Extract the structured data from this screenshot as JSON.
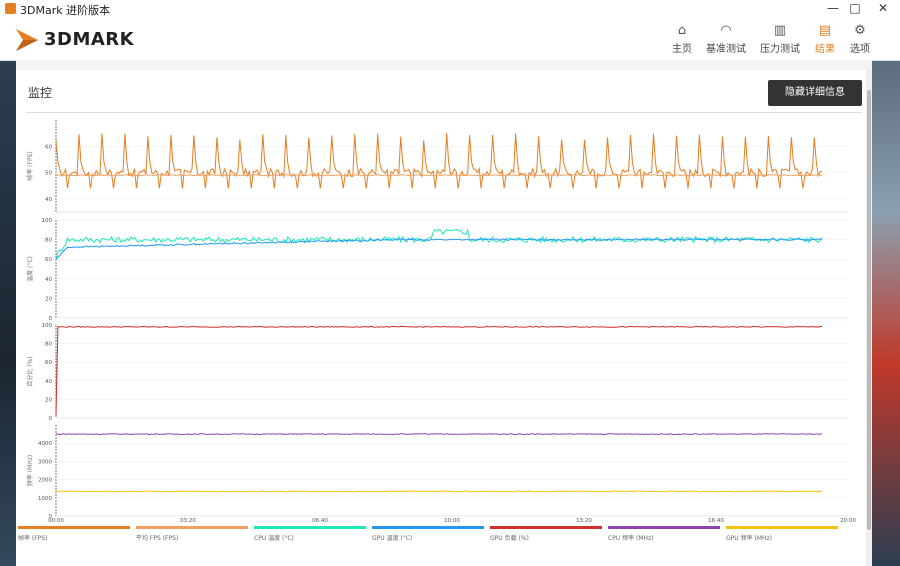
{
  "window": {
    "title": "3DMark 进阶版本",
    "controls": [
      "—",
      "□",
      "✕"
    ]
  },
  "logo": {
    "text": "3DMARK"
  },
  "nav": [
    {
      "label": "主页",
      "icon": "home-icon",
      "glyph": "⌂"
    },
    {
      "label": "基准测试",
      "icon": "gauge-icon",
      "glyph": "◠"
    },
    {
      "label": "压力测试",
      "icon": "bar-chart-icon",
      "glyph": "▥"
    },
    {
      "label": "结果",
      "icon": "results-icon",
      "glyph": "▤",
      "active": true
    },
    {
      "label": "选项",
      "icon": "gear-icon",
      "glyph": "⚙"
    }
  ],
  "panel": {
    "title": "监控",
    "hide_button": "隐藏详细信息"
  },
  "colors": {
    "accent": "#e67e22",
    "fps": "#e67e22",
    "avg_fps": "#f0a060",
    "cpu_temp": "#1de9b6",
    "gpu_temp": "#2196f3",
    "gpu_load": "#d32f2f",
    "cpu_clock": "#8e44ad",
    "gpu_clock": "#f1c40f"
  },
  "chart_data": [
    {
      "type": "line",
      "ylabel": "帧率 (FPS)",
      "yticks": [
        40,
        50,
        60
      ],
      "ylim": [
        35,
        70
      ],
      "series": [
        {
          "name": "帧率 (FPS)",
          "pattern": "spiky",
          "base": 50,
          "spike": 65,
          "low": 44
        },
        {
          "name": "平均 FPS (FPS)",
          "pattern": "flat",
          "base": 49
        }
      ]
    },
    {
      "type": "line",
      "ylabel": "温度 (°C)",
      "yticks": [
        0,
        20,
        40,
        60,
        80,
        100
      ],
      "ylim": [
        0,
        100
      ],
      "series": [
        {
          "name": "CPU 温度 (°C)",
          "pattern": "noisy",
          "base": 80
        },
        {
          "name": "GPU 温度 (°C)",
          "pattern": "rise",
          "base": 80
        }
      ]
    },
    {
      "type": "line",
      "ylabel": "百分比 (%)",
      "yticks": [
        0,
        20,
        40,
        60,
        80,
        100
      ],
      "ylim": [
        0,
        100
      ],
      "series": [
        {
          "name": "GPU 负载 (%)",
          "pattern": "flat",
          "base": 98
        }
      ]
    },
    {
      "type": "line",
      "ylabel": "频率 (MHz)",
      "yticks": [
        0,
        1000,
        2000,
        3000,
        4000
      ],
      "ylim": [
        0,
        5000
      ],
      "series": [
        {
          "name": "CPU 频率 (MHz)",
          "pattern": "flat",
          "base": 4500
        },
        {
          "name": "GPU 频率 (MHz)",
          "pattern": "flat",
          "base": 1350
        }
      ]
    }
  ],
  "xticks": [
    "00:00",
    "03:20",
    "06:40",
    "10:00",
    "13:20",
    "16:40",
    "20:00"
  ],
  "legend": [
    {
      "label": "帧率 (FPS)",
      "color": "#e67e22"
    },
    {
      "label": "平均 FPS (FPS)",
      "color": "#f0a060"
    },
    {
      "label": "CPU 温度 (°C)",
      "color": "#1de9b6"
    },
    {
      "label": "GPU 温度 (°C)",
      "color": "#2196f3"
    },
    {
      "label": "GPU 负载 (%)",
      "color": "#d32f2f"
    },
    {
      "label": "CPU 频率 (MHz)",
      "color": "#8e44ad"
    },
    {
      "label": "GPU 频率 (MHz)",
      "color": "#f1c40f"
    }
  ]
}
